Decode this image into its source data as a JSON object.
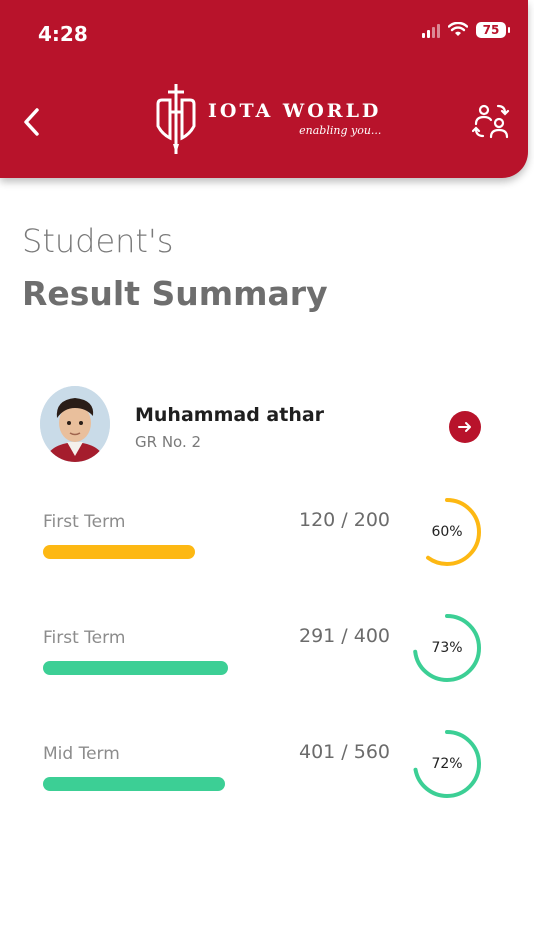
{
  "status": {
    "time": "4:28",
    "battery": "75"
  },
  "header": {
    "brand": "IOTA WORLD",
    "tagline": "enabling you...",
    "accent": "#b8132b"
  },
  "page": {
    "title_light": "Student's",
    "title_bold": "Result Summary"
  },
  "student": {
    "name": "Muhammad athar",
    "gr": "GR No. 2"
  },
  "results": [
    {
      "term": "First Term",
      "score": "120 / 200",
      "percent_label": "60%",
      "percent": 60,
      "color": "#fdb813"
    },
    {
      "term": "First Term",
      "score": "291 / 400",
      "percent_label": "73%",
      "percent": 73,
      "color": "#3ccf95"
    },
    {
      "term": "Mid Term",
      "score": "401 / 560",
      "percent_label": "72%",
      "percent": 72,
      "color": "#3ccf95"
    }
  ]
}
